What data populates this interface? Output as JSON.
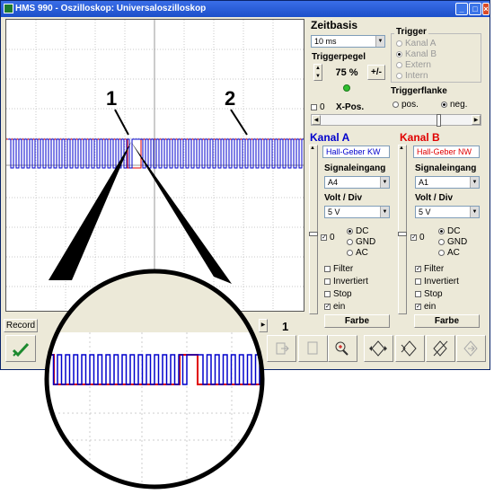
{
  "window": {
    "title": "HMS 990 - Oszilloskop: Universaloszilloskop"
  },
  "callouts": {
    "one": "1",
    "two": "2"
  },
  "timebase": {
    "title": "Zeitbasis",
    "value": "10 ms",
    "trigger_level_label": "Triggerpegel",
    "trigger_level_value": "75 %",
    "plusminus": "+/-",
    "xpos_value": "0",
    "xpos_label": "X-Pos."
  },
  "trigger": {
    "title": "Trigger",
    "options": [
      "Kanal A",
      "Kanal B",
      "Extern",
      "Intern"
    ],
    "edge_label": "Triggerflanke",
    "edge_options": [
      "pos.",
      "neg."
    ]
  },
  "channel_a": {
    "title": "Kanal A",
    "sensor": "Hall-Geber KW (I",
    "input_label": "Signaleingang",
    "input_value": "A4",
    "volt_label": "Volt / Div",
    "volt_value": "5 V",
    "offset_value": "0",
    "coupling": [
      "DC",
      "GND",
      "AC"
    ],
    "options": [
      "Filter",
      "Invertiert",
      "Stop",
      "ein"
    ],
    "color_button": "Farbe",
    "color": "#0000ff"
  },
  "channel_b": {
    "title": "Kanal B",
    "sensor": "Hall-Geber NW (I",
    "input_label": "Signaleingang",
    "input_value": "A1",
    "volt_label": "Volt / Div",
    "volt_value": "5 V",
    "offset_value": "0",
    "coupling": [
      "DC",
      "GND",
      "AC"
    ],
    "options": [
      "Filter",
      "Invertiert",
      "Stop",
      "ein"
    ],
    "color_button": "Farbe",
    "color": "#ff0000"
  },
  "record": {
    "label": "Record",
    "page": "1"
  },
  "toolbar": {
    "icons": [
      "check-icon",
      "export-icon",
      "blank-icon",
      "zoom-icon",
      "cursor-diamond-icon",
      "cursor-arrow-icon",
      "no-measure-icon",
      "nav-icon"
    ]
  }
}
